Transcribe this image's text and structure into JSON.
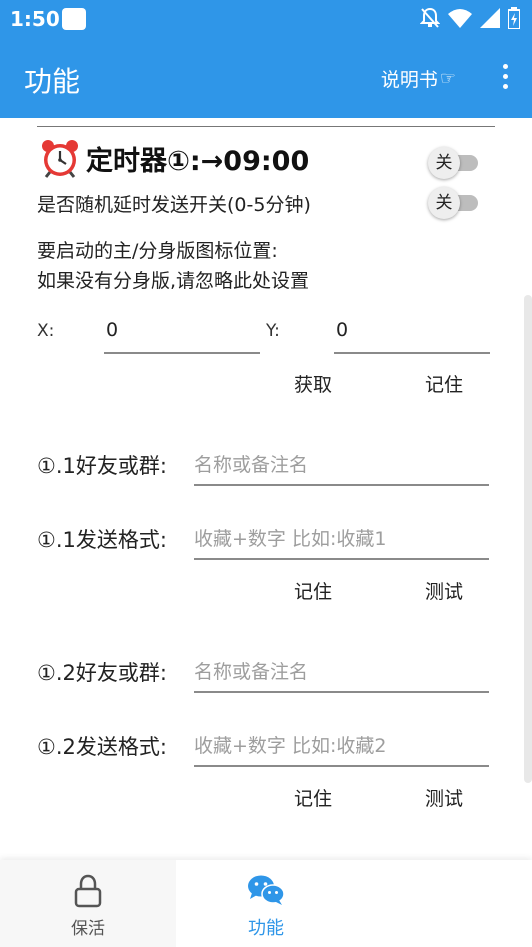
{
  "status_bar": {
    "time": "1:50",
    "icons": [
      "app-notification-icon",
      "notifications-off-icon",
      "wifi-icon",
      "signal-icon",
      "battery-icon"
    ]
  },
  "app_bar": {
    "title": "功能",
    "manual_label": "说明书",
    "manual_icon": "☞",
    "background": "#2f96e8"
  },
  "timer": {
    "icon": "alarm-clock-icon",
    "title": "定时器①:→09:00",
    "switch_label": "关",
    "switch_on": false
  },
  "random_delay": {
    "label": "是否随机延时发送开关(0-5分钟)",
    "switch_label": "关",
    "switch_on": false
  },
  "position_hint": {
    "line1": "要启动的主/分身版图标位置:",
    "line2": "如果没有分身版,请忽略此处设置"
  },
  "coords": {
    "x_label": "X:",
    "x_value": "0",
    "y_label": "Y:",
    "y_value": "0",
    "get_button": "获取",
    "save_button": "记住"
  },
  "groups": [
    {
      "friend_label": "①.1好友或群:",
      "friend_placeholder": "名称或备注名",
      "format_label": "①.1发送格式:",
      "format_placeholder": "收藏+数字 比如:收藏1",
      "save_button": "记住",
      "test_button": "测试"
    },
    {
      "friend_label": "①.2好友或群:",
      "friend_placeholder": "名称或备注名",
      "format_label": "①.2发送格式:",
      "format_placeholder": "收藏+数字 比如:收藏2",
      "save_button": "记住",
      "test_button": "测试"
    }
  ],
  "bottom_nav": {
    "items": [
      {
        "label": "保活",
        "icon": "lock-icon",
        "active": false
      },
      {
        "label": "功能",
        "icon": "wechat-icon",
        "active": true
      }
    ],
    "active_color": "#2f96e8"
  }
}
